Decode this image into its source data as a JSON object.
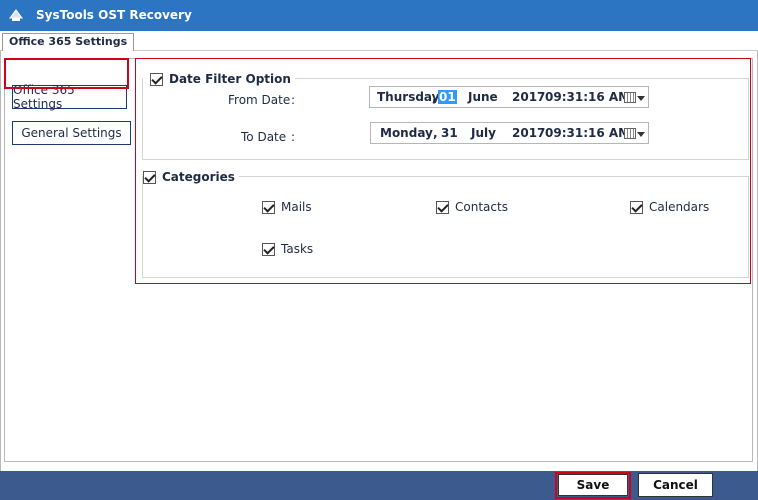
{
  "window": {
    "title": "SysTools  OST Recovery"
  },
  "tabs": [
    {
      "label": "Office 365 Settings"
    }
  ],
  "nav": {
    "office365": "Office 365 Settings",
    "general": "General Settings"
  },
  "date_filter": {
    "title": "Date Filter Option",
    "checked": true,
    "from": {
      "label": "From Date",
      "colon": ":",
      "weekday": "Thursday",
      "sep": ",",
      "day": "01",
      "month": "June",
      "year": "2017",
      "time": "09:31:16 AM"
    },
    "to": {
      "label": "To Date",
      "colon": ":",
      "weekday": "Monday",
      "sep": ",",
      "day": "31",
      "month": "July",
      "year": "2017",
      "time": "09:31:16 AM"
    }
  },
  "categories": {
    "title": "Categories",
    "checked": true,
    "items": [
      {
        "label": "Mails",
        "checked": true
      },
      {
        "label": "Contacts",
        "checked": true
      },
      {
        "label": "Calendars",
        "checked": true
      },
      {
        "label": "Tasks",
        "checked": true
      }
    ]
  },
  "buttons": {
    "save": "Save",
    "cancel": "Cancel"
  },
  "colors": {
    "titlebar": "#2b75c3",
    "bottombar": "#3d5a8e",
    "highlight": "#d0021b",
    "selection": "#3399ff"
  }
}
